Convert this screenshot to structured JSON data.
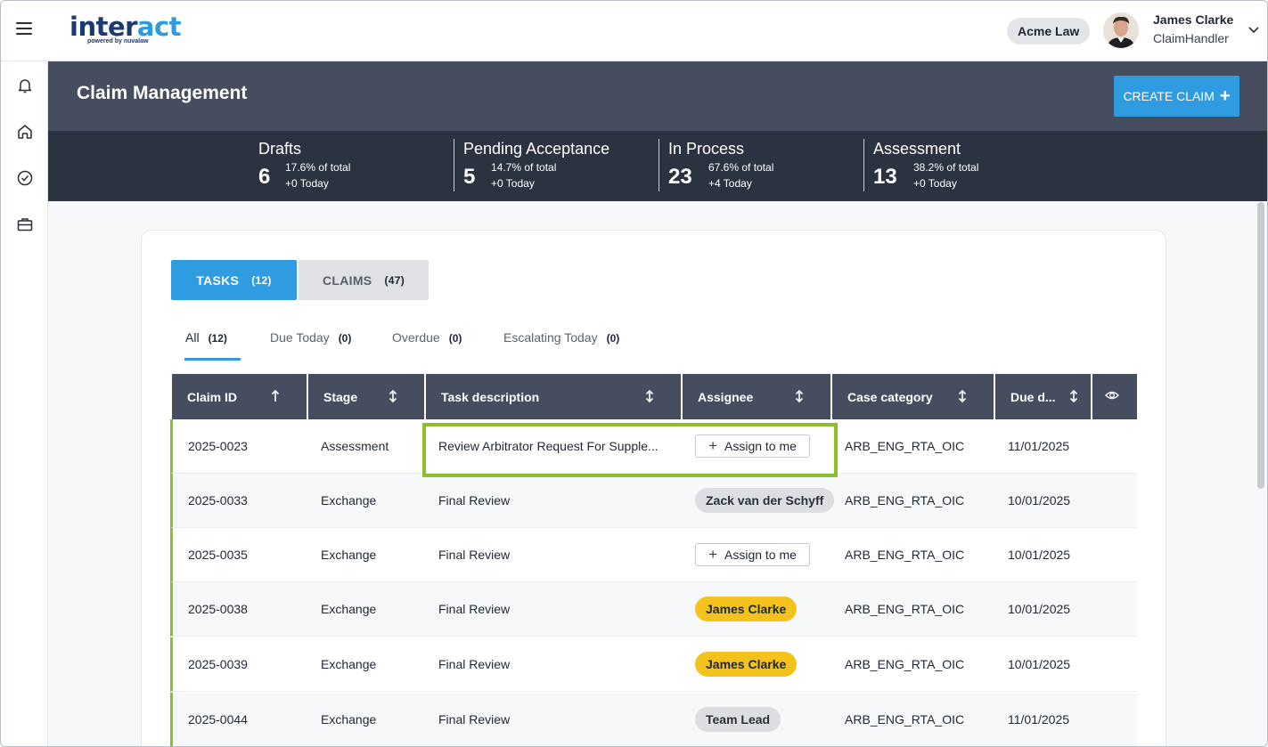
{
  "app": {
    "logo_part1": "inter",
    "logo_part2": "act",
    "logo_tagline": "powered by nuvalaw",
    "organization": "Acme Law",
    "user": {
      "name": "James Clarke",
      "role": "ClaimHandler"
    }
  },
  "sidebar": {
    "icons": [
      "bell-icon",
      "home-icon",
      "check-circle-icon",
      "briefcase-icon"
    ]
  },
  "header": {
    "title": "Claim Management",
    "create_button": "CREATE CLAIM"
  },
  "stats": [
    {
      "label": "Drafts",
      "count": "6",
      "pct": "17.6% of total",
      "today": "+0 Today"
    },
    {
      "label": "Pending Acceptance",
      "count": "5",
      "pct": "14.7% of total",
      "today": "+0 Today"
    },
    {
      "label": "In Process",
      "count": "23",
      "pct": "67.6% of total",
      "today": "+4 Today"
    },
    {
      "label": "Assessment",
      "count": "13",
      "pct": "38.2% of total",
      "today": "+0 Today"
    }
  ],
  "tabs": [
    {
      "label": "TASKS",
      "count": "(12)",
      "active": true
    },
    {
      "label": "CLAIMS",
      "count": "(47)",
      "active": false
    }
  ],
  "filters": [
    {
      "label": "All",
      "count": "(12)"
    },
    {
      "label": "Due Today",
      "count": "(0)"
    },
    {
      "label": "Overdue",
      "count": "(0)"
    },
    {
      "label": "Escalating Today",
      "count": "(0)"
    }
  ],
  "table": {
    "columns": [
      "Claim ID",
      "Stage",
      "Task description",
      "Assignee",
      "Case category",
      "Due d..."
    ],
    "assign_label": "Assign to me",
    "rows": [
      {
        "claim_id": "2025-0023",
        "stage": "Assessment",
        "task": "Review Arbitrator Request For Supple...",
        "assignee": "",
        "assignee_style": "button",
        "category": "ARB_ENG_RTA_OIC",
        "due": "11/01/2025"
      },
      {
        "claim_id": "2025-0033",
        "stage": "Exchange",
        "task": "Final Review",
        "assignee": "Zack van der Schyff",
        "assignee_style": "gray",
        "category": "ARB_ENG_RTA_OIC",
        "due": "10/01/2025"
      },
      {
        "claim_id": "2025-0035",
        "stage": "Exchange",
        "task": "Final Review",
        "assignee": "",
        "assignee_style": "button",
        "category": "ARB_ENG_RTA_OIC",
        "due": "10/01/2025"
      },
      {
        "claim_id": "2025-0038",
        "stage": "Exchange",
        "task": "Final Review",
        "assignee": "James Clarke",
        "assignee_style": "yellow",
        "category": "ARB_ENG_RTA_OIC",
        "due": "10/01/2025"
      },
      {
        "claim_id": "2025-0039",
        "stage": "Exchange",
        "task": "Final Review",
        "assignee": "James Clarke",
        "assignee_style": "yellow",
        "category": "ARB_ENG_RTA_OIC",
        "due": "10/01/2025"
      },
      {
        "claim_id": "2025-0044",
        "stage": "Exchange",
        "task": "Final Review",
        "assignee": "Team Lead",
        "assignee_style": "gray",
        "category": "ARB_ENG_RTA_OIC",
        "due": "11/01/2025"
      }
    ]
  },
  "colors": {
    "accent": "#2f9be0",
    "header": "#454d5e",
    "row_marker": "#8bc02a",
    "chip_yellow": "#f3c21d"
  }
}
